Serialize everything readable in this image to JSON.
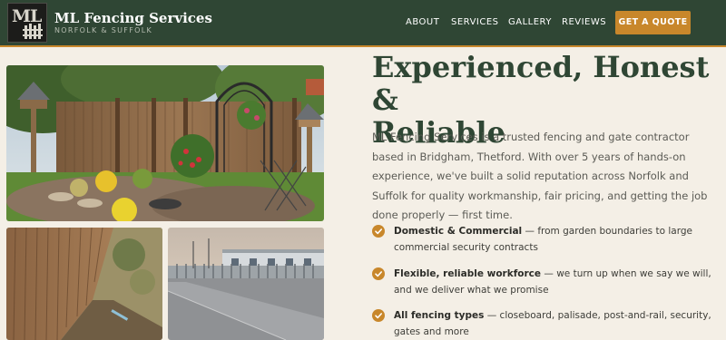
{
  "brand": {
    "logo_monogram": "ML",
    "name": "ML Fencing Services",
    "tagline": "NORFOLK & SUFFOLK"
  },
  "nav": {
    "items": [
      "ABOUT",
      "SERVICES",
      "GALLERY",
      "REVIEWS"
    ],
    "cta_label": "GET A QUOTE"
  },
  "about": {
    "headline_line1": "Experienced, Honest &",
    "headline_line2": "Reliable",
    "intro": "ML Fencing Services is a trusted fencing and gate contractor based in Bridgham, Thetford. With over 5 years of hands-on experience, we've built a solid reputation across Norfolk and Suffolk for quality workmanship, fair pricing, and getting the job done properly — first time.",
    "features": [
      {
        "title": "Domestic & Commercial",
        "text": " — from garden boundaries to large commercial security contracts"
      },
      {
        "title": "Flexible, reliable workforce",
        "text": " — we turn up when we say we will, and we deliver what we promise"
      },
      {
        "title": "All fencing types",
        "text": " — closeboard, palisade, post-and-rail, security, gates and more"
      }
    ]
  },
  "gallery": {
    "photos": [
      "garden-fence-photo",
      "closeboard-fence-photo",
      "palisade-fence-photo"
    ]
  },
  "colors": {
    "header_bg": "#2f4634",
    "accent": "#c8872b",
    "page_bg": "#f4efe6",
    "headline": "#2f4634"
  }
}
